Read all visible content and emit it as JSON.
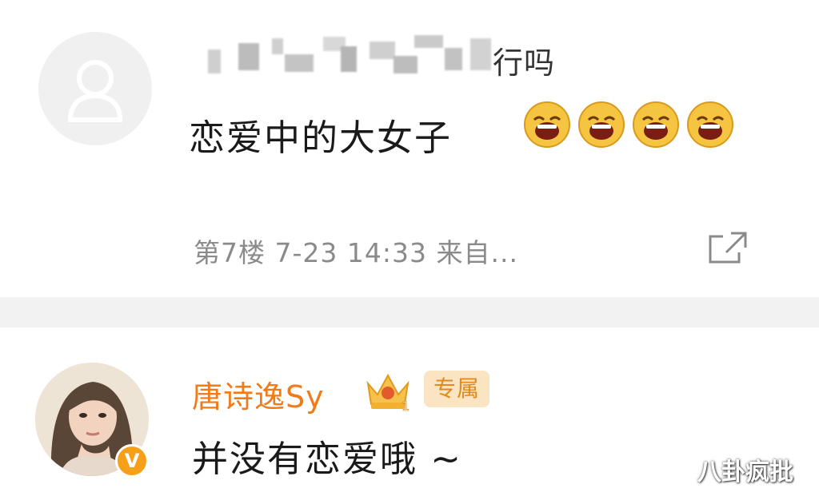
{
  "comment_first": {
    "name_tail": "行吗",
    "text": "恋爱中的大女子",
    "emojis": [
      "laugh-emoji",
      "laugh-emoji",
      "laugh-emoji",
      "laugh-emoji"
    ],
    "floor": "第7楼",
    "timestamp": "7-23 14:33",
    "source": "来自...",
    "share_icon": "share-icon"
  },
  "comment_second": {
    "username": "唐诗逸Sy",
    "member_level": "1",
    "tag": "专属",
    "verified_badge": "V",
    "text": "并没有恋爱哦 ~"
  },
  "watermark": "八卦疯批",
  "colors": {
    "username": "#f07b1b",
    "meta": "#8a8a8a",
    "divider": "#f2f2f2",
    "verified": "#f6a01a",
    "tag_bg": "#fbe4c1"
  }
}
